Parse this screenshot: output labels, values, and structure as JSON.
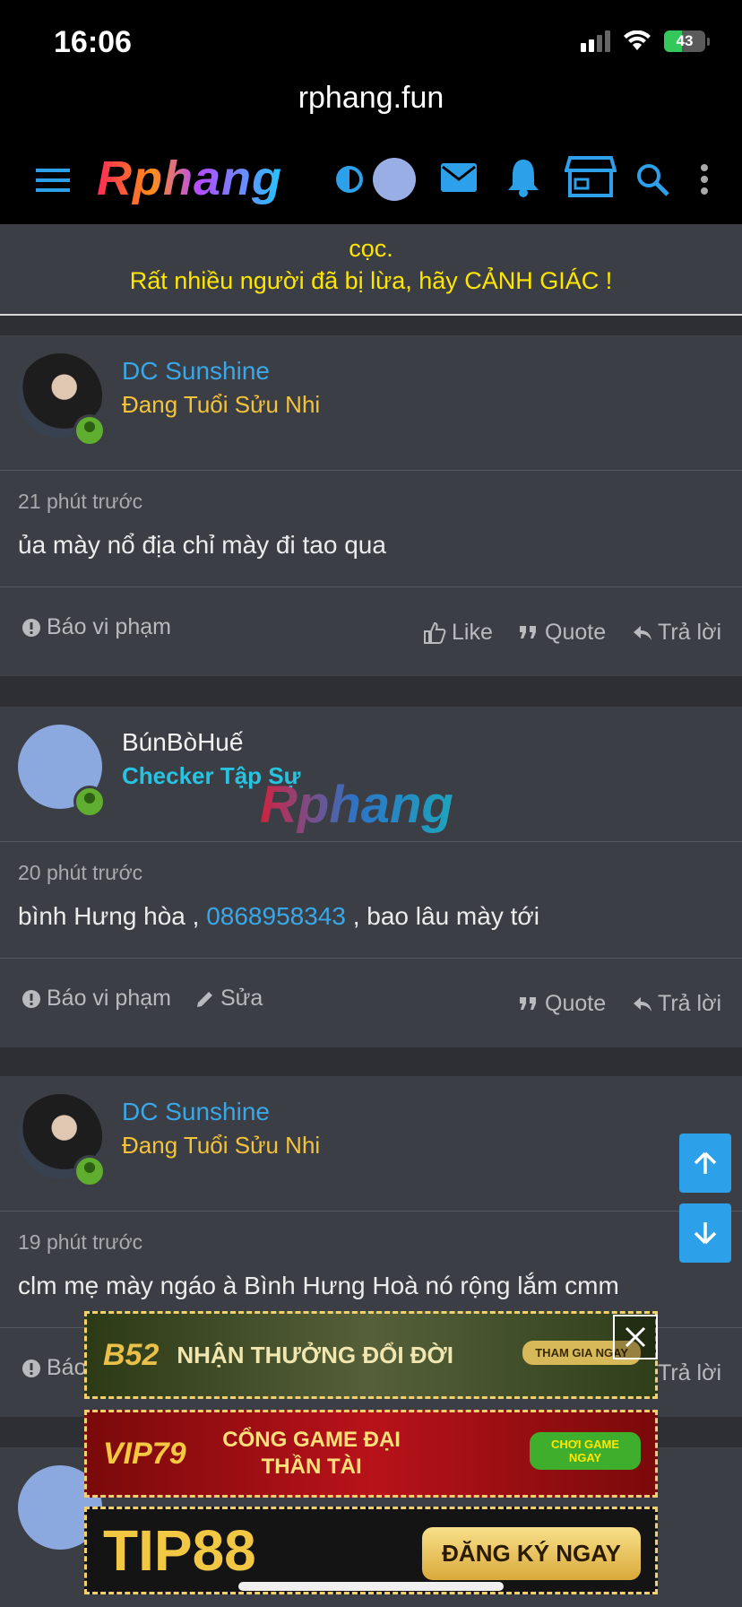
{
  "status_bar": {
    "time": "16:06",
    "battery": "43"
  },
  "browser": {
    "url": "rphang.fun"
  },
  "nav": {
    "logo": "Rphang"
  },
  "banner": {
    "line1": "cọc.",
    "line2": "Rất nhiều người đã bị lừa, hãy CẢNH GIÁC !"
  },
  "watermark": "Rphang",
  "posts": [
    {
      "username": "DC Sunshine",
      "username_color": "#3aa7e8",
      "role": "Đang Tuổi Sửu Nhi",
      "role_color": "#f3c33a",
      "time": "21 phút trước",
      "content": "ủa mày nổ địa chỉ mày đi tao qua",
      "actions": {
        "report": "Báo vi phạm",
        "like": "Like",
        "quote": "Quote",
        "reply": "Trả lời"
      }
    },
    {
      "username": "BúnBòHuế",
      "username_color": "#f2f2f2",
      "role": "Checker Tập Sự",
      "role_color": "#27c3e0",
      "time": "20 phút trước",
      "content_before": "bình Hưng hòa , ",
      "content_phone": "0868958343",
      "content_after": " , bao lâu mày tới",
      "actions": {
        "report": "Báo vi phạm",
        "edit": "Sửa",
        "quote": "Quote",
        "reply": "Trả lời"
      }
    },
    {
      "username": "DC Sunshine",
      "username_color": "#3aa7e8",
      "role": "Đang Tuổi Sửu Nhi",
      "role_color": "#f3c33a",
      "time": "19 phút trước",
      "content": "clm mẹ mày ngáo à Bình Hưng Hoà nó rộng lắm cmm",
      "actions": {
        "report": "Báo",
        "reply": "Trả lời"
      }
    }
  ],
  "ads": [
    {
      "brand": "B52",
      "text": "NHẬN THƯỞNG ĐỔI ĐỜI",
      "cta": "THAM GIA NGAY"
    },
    {
      "brand": "VIP79",
      "text": "CỔNG GAME ĐẠI THẦN TÀI",
      "cta": "CHƠI GAME NGAY"
    },
    {
      "brand": "TIP88",
      "text": "",
      "cta": "ĐĂNG KÝ NGAY"
    }
  ],
  "colors": {
    "accent": "#2da0ea",
    "banner_text": "#ffe600",
    "background": "#2d2f34",
    "card": "#3b3e44"
  }
}
